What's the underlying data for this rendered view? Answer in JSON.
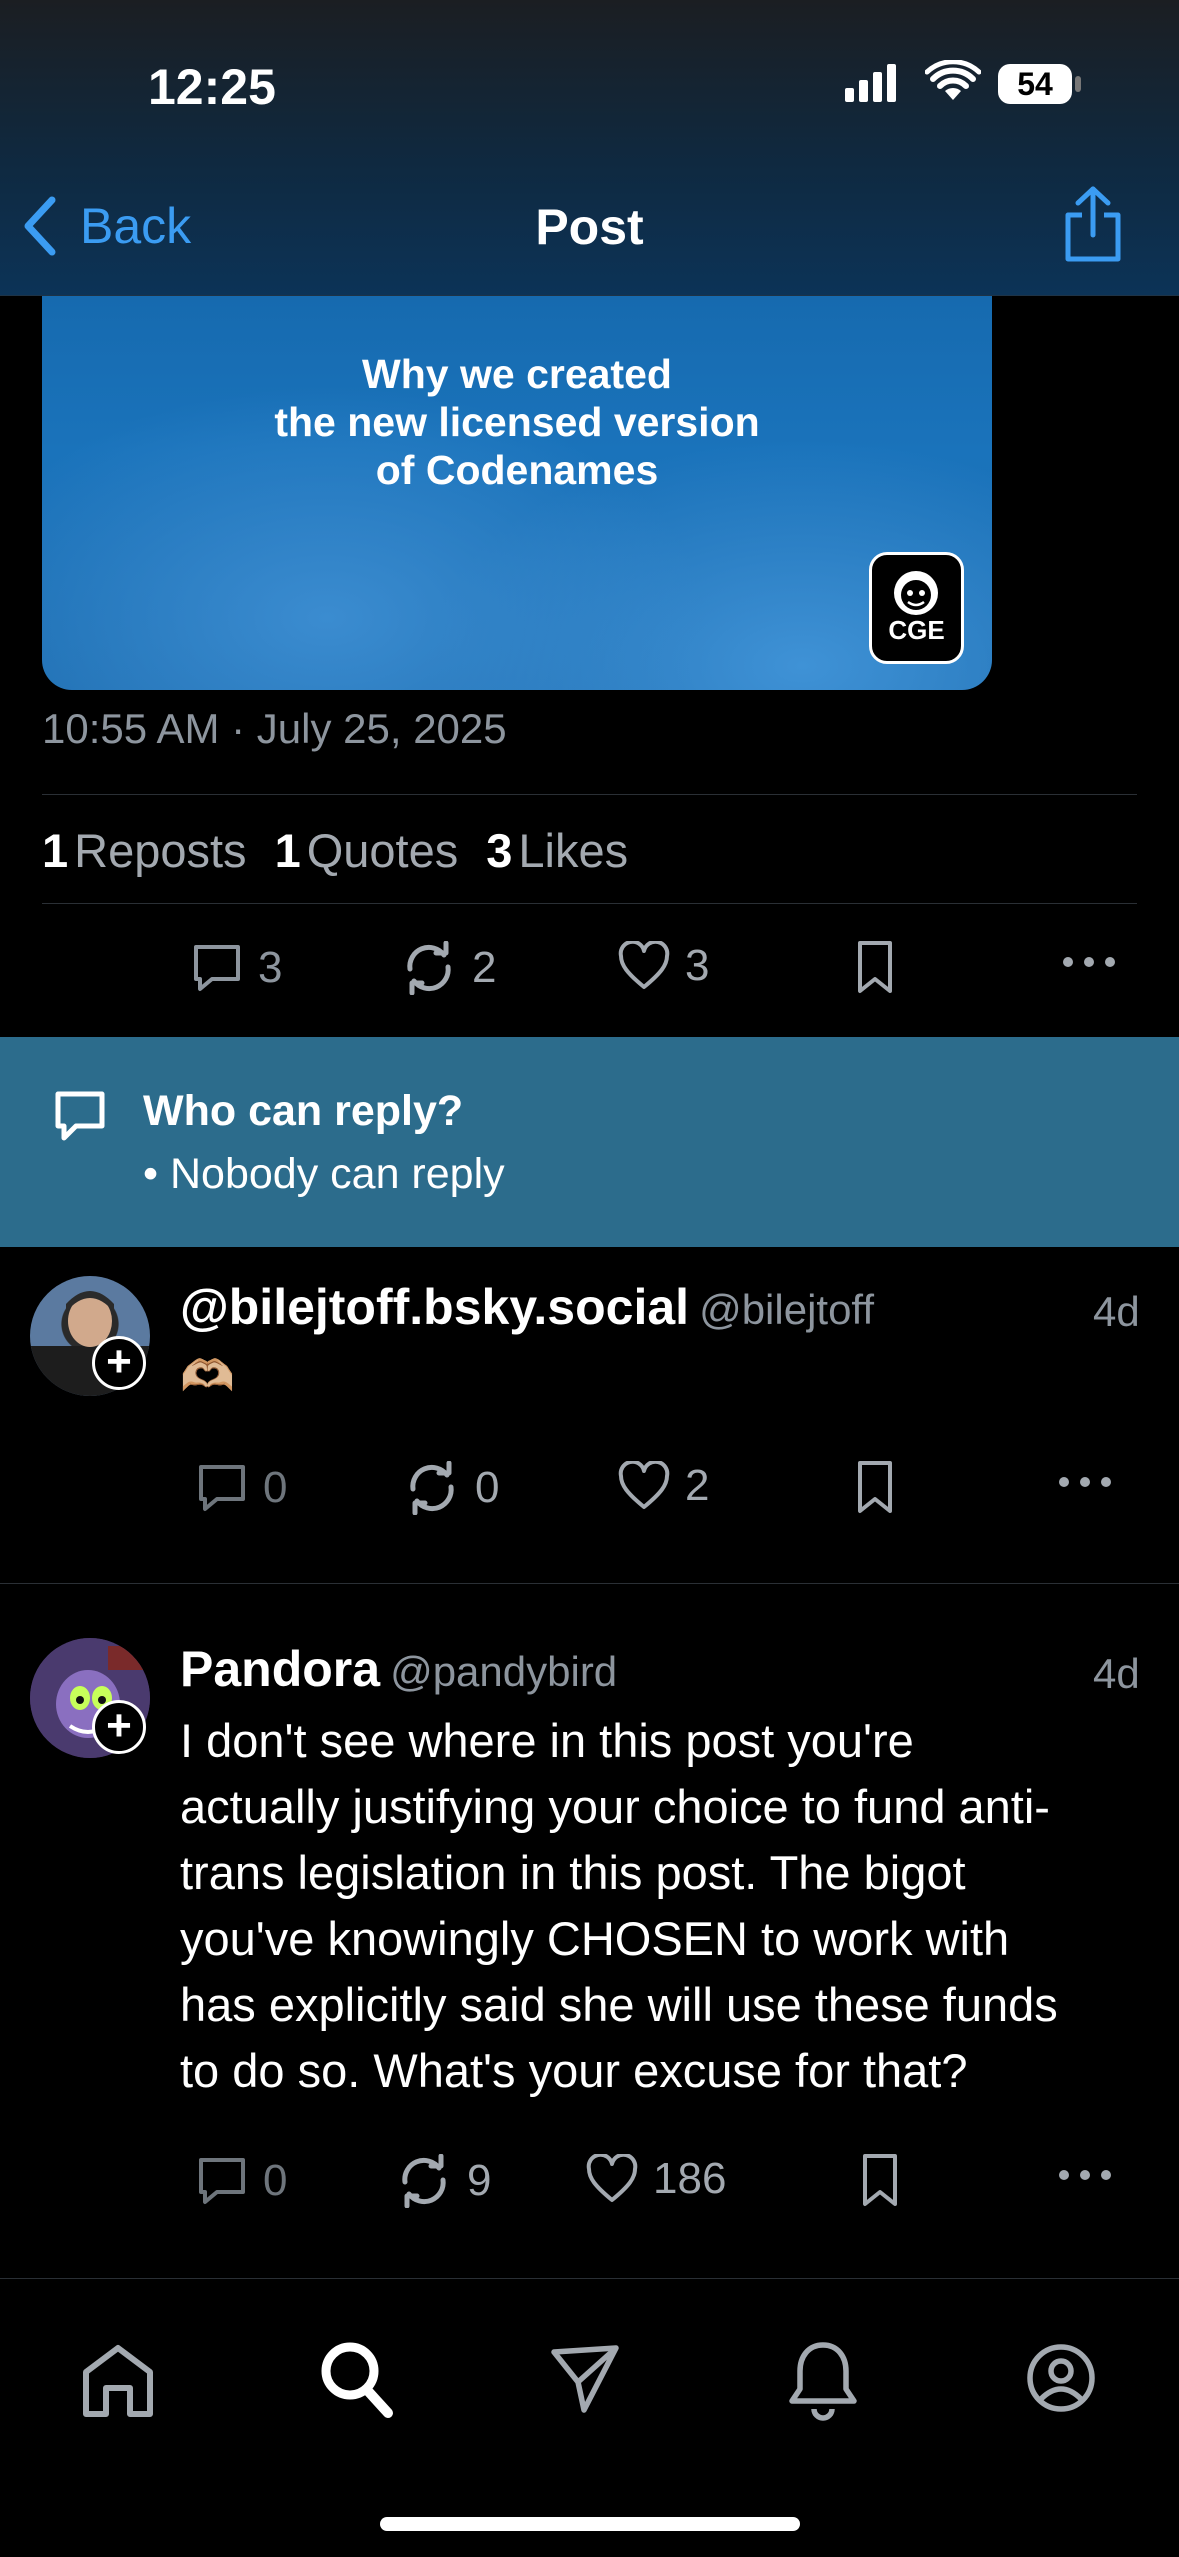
{
  "status_bar": {
    "time": "12:25",
    "battery": "54"
  },
  "header": {
    "back_label": "Back",
    "title": "Post"
  },
  "post": {
    "embed_title": "Why we created\nthe new licensed version\nof Codenames",
    "embed_logo_text": "CGE",
    "timestamp": "10:55 AM · July 25, 2025",
    "stats": {
      "reposts_count": "1",
      "reposts_label": "Reposts",
      "quotes_count": "1",
      "quotes_label": "Quotes",
      "likes_count": "3",
      "likes_label": "Likes"
    },
    "actions": {
      "replies": "3",
      "reposts": "2",
      "likes": "3"
    }
  },
  "reply_settings": {
    "title": "Who can reply?",
    "subtitle": "• Nobody can reply"
  },
  "replies": [
    {
      "display_name": "@bilejtoff.bsky.social",
      "handle": "@bilejtoff",
      "age": "4d",
      "text": "🫶🏼",
      "actions": {
        "replies": "0",
        "reposts": "0",
        "likes": "2"
      }
    },
    {
      "display_name": "Pandora",
      "handle": "@pandybird",
      "age": "4d",
      "text_lines": [
        "I don't see where in this post you're",
        "actually justifying your choice to fund anti-",
        "trans legislation in this post. The bigot",
        "you've knowingly CHOSEN to work with",
        "has explicitly said she will use these funds",
        "to do so. What's your excuse for that?"
      ],
      "actions": {
        "replies": "0",
        "reposts": "9",
        "likes": "186"
      }
    }
  ],
  "tabbar": {
    "items": [
      "home-icon",
      "search-icon",
      "messages-icon",
      "notifications-icon",
      "profile-icon"
    ],
    "active": "search-icon"
  },
  "colors": {
    "accent": "#3b9cf2",
    "reply_settings_bg": "#2c6c8c",
    "muted": "#8d959e"
  }
}
